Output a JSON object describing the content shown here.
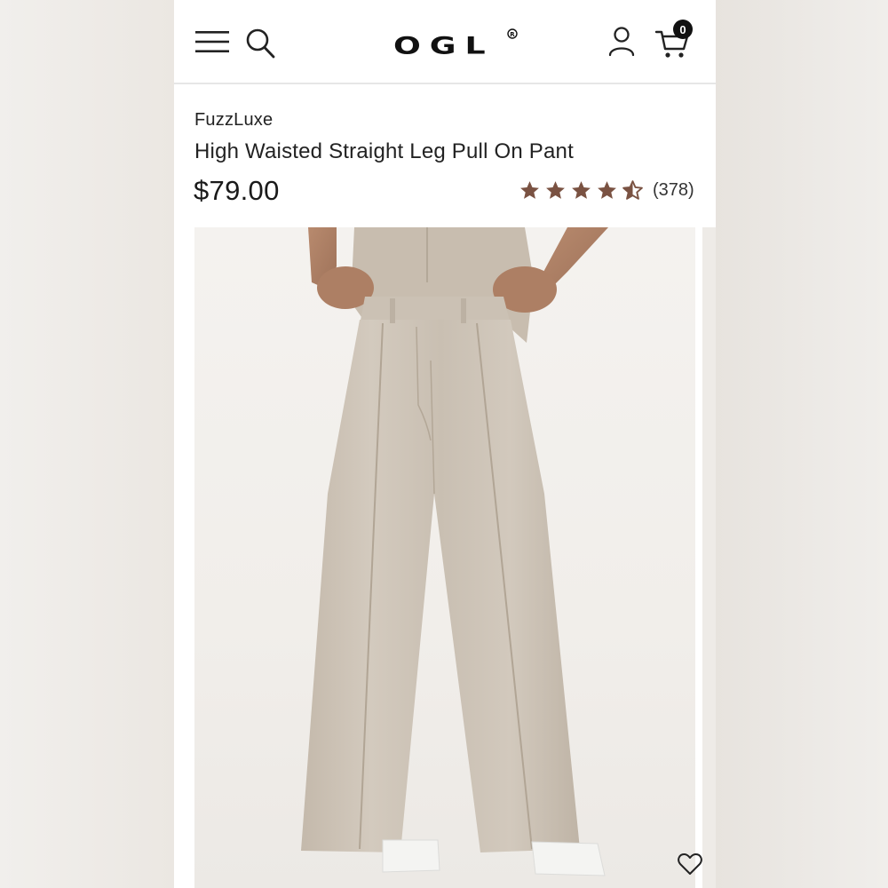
{
  "header": {
    "logo_text": "OGL",
    "cart_count": "0",
    "icons": [
      "hamburger-menu-icon",
      "search-icon",
      "account-icon",
      "cart-icon"
    ]
  },
  "product": {
    "brand": "FuzzLuxe",
    "title": "High Waisted Straight Leg Pull On Pant",
    "price": "$79.00",
    "rating": {
      "stars": 4.5,
      "count_label": "(378)"
    },
    "image": {
      "subject": "beige high waisted straight leg pull on pant",
      "wishlist_icon": "heart-icon"
    }
  },
  "colors": {
    "star": "#7a5242",
    "accent": "#111111",
    "pant": "#cdc3b6",
    "background": "#efece8"
  }
}
